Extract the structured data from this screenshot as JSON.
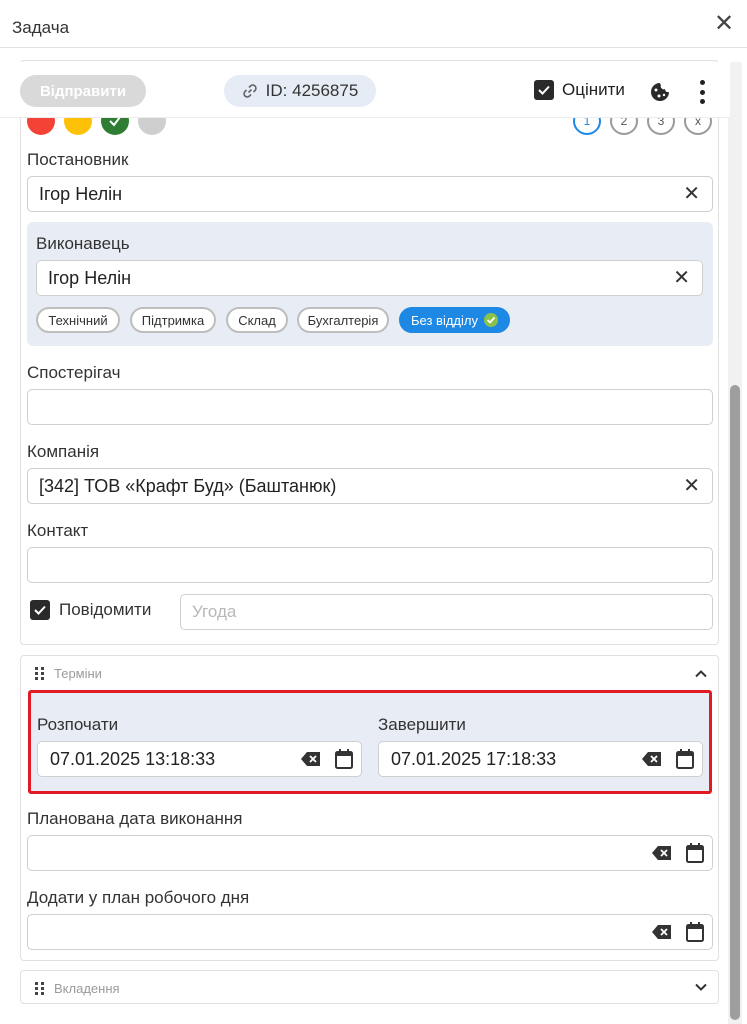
{
  "window": {
    "title": "Задача"
  },
  "toolbar": {
    "send_label": "Відправити",
    "id_text": "ID: 4256875",
    "rate_label": "Оцінити",
    "rate_checked": true
  },
  "status_dots": [
    {
      "color": "#f44336"
    },
    {
      "color": "#ffc107"
    },
    {
      "color": "#2e7d32",
      "checked": true
    },
    {
      "color": "#cfcfcf"
    }
  ],
  "steps": [
    "1",
    "2",
    "3",
    "x"
  ],
  "author": {
    "label": "Постановник",
    "value": "Ігор Нелін"
  },
  "executor": {
    "label": "Виконавець",
    "value": "Ігор Нелін",
    "departments": [
      "Технічний",
      "Підтримка",
      "Склад",
      "Бухгалтерія",
      "Без відділу"
    ],
    "active_department": "Без відділу"
  },
  "observer": {
    "label": "Спостерігач",
    "value": ""
  },
  "company": {
    "label": "Компанія",
    "value": "[342] ТОВ «Крафт Буд» (Баштанюк)"
  },
  "contact": {
    "label": "Контакт",
    "value": ""
  },
  "notify": {
    "label": "Повідомити",
    "checked": true,
    "agreement_placeholder": "Угода"
  },
  "terms": {
    "title": "Терміни",
    "start": {
      "label": "Розпочати",
      "value": "07.01.2025 13:18:33"
    },
    "end": {
      "label": "Завершити",
      "value": "07.01.2025 17:18:33"
    },
    "planned": {
      "label": "Планована дата виконання",
      "value": ""
    },
    "workday": {
      "label": "Додати у план робочого дня",
      "value": ""
    }
  },
  "attachments": {
    "title": "Вкладення"
  },
  "colors": {
    "accent": "#1e88e5",
    "highlight": "#e01b24",
    "panel": "#e8ecf4"
  }
}
